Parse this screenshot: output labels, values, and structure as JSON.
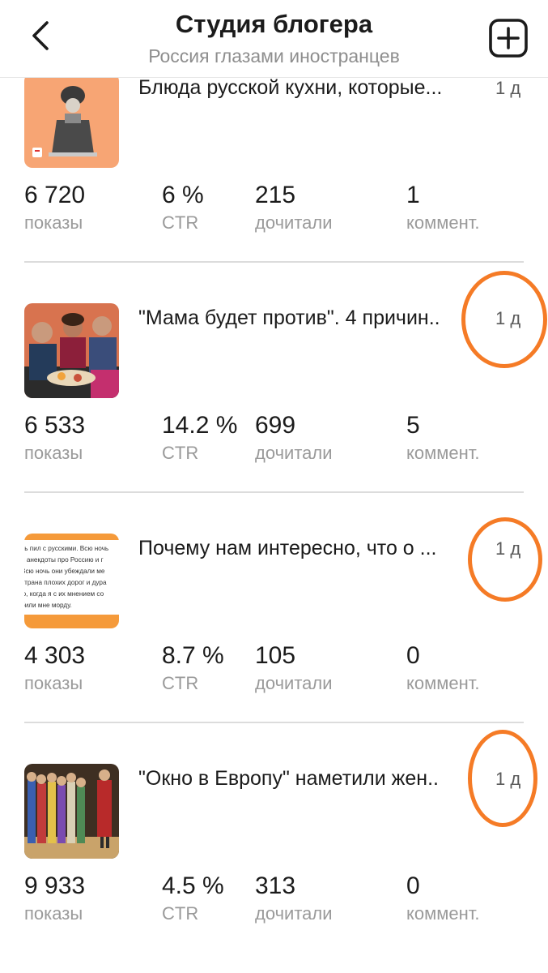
{
  "header": {
    "title": "Студия блогера",
    "subtitle": "Россия глазами иностранцев"
  },
  "stat_labels": {
    "views": "показы",
    "ctr": "CTR",
    "read": "дочитали",
    "comments": "коммент."
  },
  "posts": [
    {
      "title": "Блюда русской кухни, которые...",
      "age": "1 д",
      "views": "6 720",
      "ctr": "6 %",
      "read": "215",
      "comments": "1",
      "highlighted": false
    },
    {
      "title": "\"Мама будет против\". 4 причин..",
      "age": "1 д",
      "views": "6 533",
      "ctr": "14.2 %",
      "read": "699",
      "comments": "5",
      "highlighted": true
    },
    {
      "title": "Почему нам интересно, что о ...",
      "age": "1 д",
      "views": "4 303",
      "ctr": "8.7 %",
      "read": "105",
      "comments": "0",
      "highlighted": true
    },
    {
      "title": "\"Окно в Европу\" наметили жен..",
      "age": "1 д",
      "views": "9 933",
      "ctr": "4.5 %",
      "read": "313",
      "comments": "0",
      "highlighted": true
    }
  ],
  "thumbnail_text": {
    "post3_lines": [
      "чь пил с русскими. Всю ночь",
      "и анекдоты про Россию и г",
      "Всю ночь они убеждали ме",
      "страна плохих дорог и дура",
      "ю, когда я с их мнением со",
      "били мне морду."
    ]
  },
  "colors": {
    "accent_ring": "#f57b26",
    "thumb1_bg": "#f7a574",
    "thumb3_band": "#f59a3a"
  },
  "icons": {
    "back": "chevron-left-icon",
    "add": "plus-square-icon"
  }
}
